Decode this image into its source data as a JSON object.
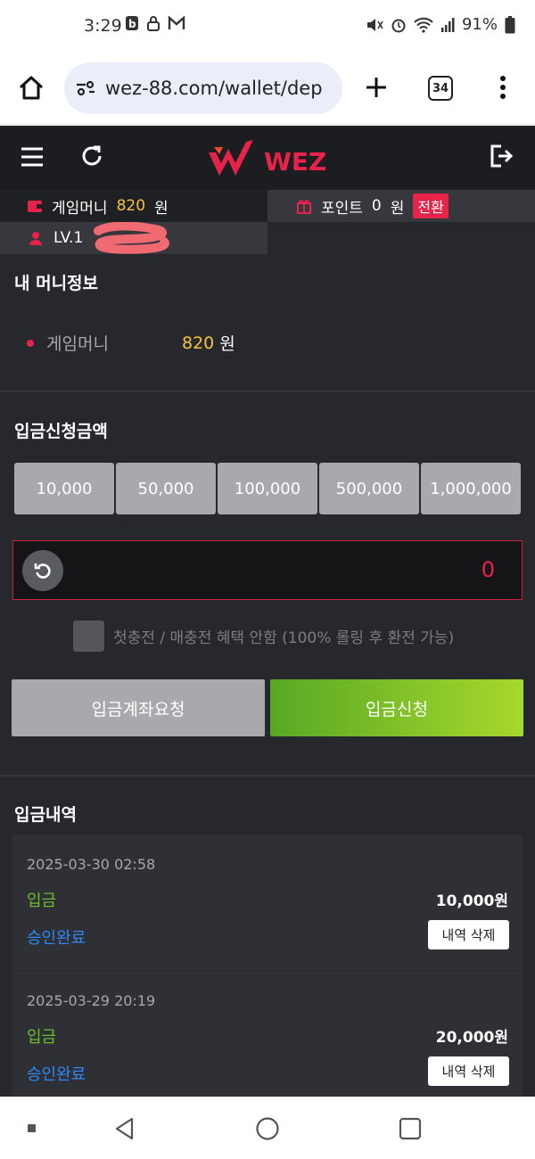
{
  "status_bar": {
    "time": "3:29",
    "battery": "91%",
    "icons": [
      "b-icon",
      "lock-icon",
      "gmail-icon",
      "mute-icon",
      "alarm-icon",
      "wifi-icon",
      "signal-icon",
      "battery-icon"
    ]
  },
  "browser": {
    "url": "wez-88.com/wallet/dep",
    "tab_count": "34"
  },
  "header": {
    "logo_text": "WEZ"
  },
  "account": {
    "money_label": "게임머니",
    "money_value": "820",
    "currency": "원",
    "point_label": "포인트",
    "point_value": "0",
    "point_currency": "원",
    "convert_label": "전환",
    "level": "LV.1"
  },
  "money_info": {
    "title": "내 머니정보",
    "label": "게임머니",
    "value": "820",
    "currency": "원"
  },
  "deposit": {
    "title": "입금신청금액",
    "amount_buttons": [
      "10,000",
      "50,000",
      "100,000",
      "500,000",
      "1,000,000"
    ],
    "amount_value": "0",
    "checkbox_label": "첫충전 / 매충전 혜택 안함 (100% 롤링 후 환전 가능)",
    "account_request_label": "입금계좌요청",
    "submit_label": "입금신청"
  },
  "history": {
    "title": "입금내역",
    "items": [
      {
        "date": "2025-03-30 02:58",
        "type": "입금",
        "amount": "10,000원",
        "status": "승인완료",
        "delete_label": "내역 삭제"
      },
      {
        "date": "2025-03-29 20:19",
        "type": "입금",
        "amount": "20,000원",
        "status": "승인완료",
        "delete_label": "내역 삭제"
      }
    ]
  },
  "colors": {
    "accent_red": "#e8234a",
    "money_yellow": "#f5c33b",
    "green": "#6cbd2e",
    "blue": "#2f87f5",
    "background": "#26282d"
  }
}
